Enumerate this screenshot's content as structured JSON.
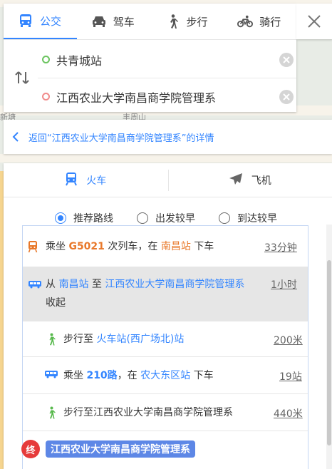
{
  "mode_tabs": [
    {
      "label": "公交",
      "icon": "bus-icon",
      "active": true
    },
    {
      "label": "驾车",
      "icon": "car-icon",
      "active": false
    },
    {
      "label": "步行",
      "icon": "walk-icon",
      "active": false
    },
    {
      "label": "骑行",
      "icon": "bike-icon",
      "active": false
    }
  ],
  "route": {
    "start": "共青城站",
    "end": "江西农业大学南昌商学院管理系"
  },
  "back_link": "返回“江西农业大学南昌商学院管理系”的详情",
  "transport_tabs": [
    {
      "label": "火车",
      "icon": "train-icon",
      "active": true
    },
    {
      "label": "飞机",
      "icon": "plane-icon",
      "active": false
    }
  ],
  "sort_options": [
    {
      "label": "推荐路线",
      "checked": true
    },
    {
      "label": "出发较早",
      "checked": false
    },
    {
      "label": "到达较早",
      "checked": false
    }
  ],
  "steps": {
    "s1": {
      "prefix": "乘坐 ",
      "train": "G5021",
      "mid": " 次列车，在 ",
      "station": "南昌站",
      "suffix": " 下车",
      "meta": "33分钟"
    },
    "s2": {
      "prefix": "从 ",
      "from": "南昌站",
      "mid": " 至 ",
      "to": "江西农业大学南昌商学院管理系",
      "line2": "收起",
      "meta": "1小时"
    },
    "s3": {
      "prefix": "步行至 ",
      "place": "火车站(西广场北)站",
      "meta": "200米"
    },
    "s4": {
      "prefix": "乘坐 ",
      "bus": "210路",
      "mid": "，在 ",
      "stop": "农大东区站",
      "suffix": " 下车",
      "meta": "19站"
    },
    "s5": {
      "text": "步行至江西农业大学南昌商学院管理系",
      "meta": "440米"
    }
  },
  "end_badge": "终",
  "end_name": "江西农业大学南昌商学院管理系",
  "map_labels": [
    "新塘",
    "丰周山"
  ],
  "colors": {
    "accent": "#3385ff",
    "orange": "#e8782a",
    "end_red": "#e63b3b",
    "end_tag": "#5d87e6",
    "walk_green": "#58b94d"
  }
}
